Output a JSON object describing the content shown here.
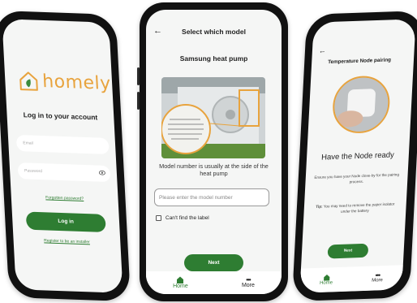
{
  "colors": {
    "brand_green": "#2e7d32",
    "brand_orange": "#e8a33d"
  },
  "login": {
    "logo_text": "homely",
    "title": "Log in to your account",
    "email_placeholder": "Email",
    "password_placeholder": "Password",
    "forgot_link": "Forgotten password?",
    "login_button": "Log in",
    "register_link": "Register to be an installer"
  },
  "model": {
    "header_title": "Select which model",
    "subtitle": "Samsung heat pump",
    "caption": "Model number is usually at the side of the heat pump",
    "input_placeholder": "Please enter the model number",
    "checkbox_label": "Can't find the label",
    "next_button": "Next",
    "nav": {
      "home": "Home",
      "more": "More"
    }
  },
  "node": {
    "header_title": "Temperature Node pairing",
    "heading": "Have the Node ready",
    "instruction": "Ensure you have your Node close-by for the pairing process.",
    "tip_label": "Tip:",
    "tip_text": " You may need to remove the paper isolator under the battery",
    "next_button": "Next",
    "nav": {
      "home": "Home",
      "more": "More"
    }
  }
}
